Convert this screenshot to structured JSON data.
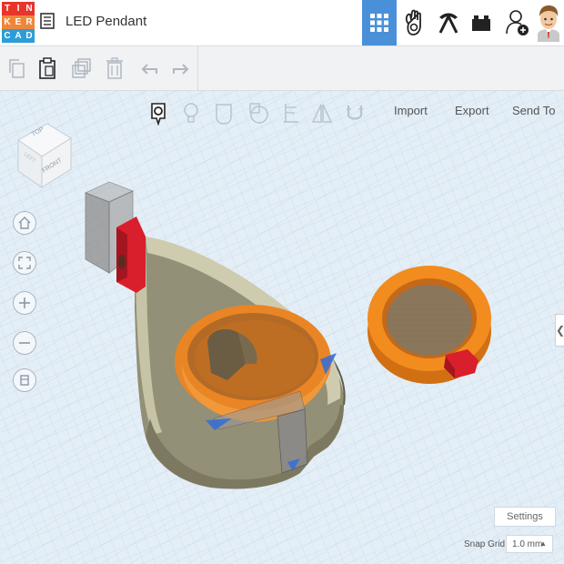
{
  "app": {
    "logo_letters": [
      "T",
      "I",
      "N",
      "K",
      "E",
      "R",
      "C",
      "A",
      "D"
    ],
    "logo_colors": [
      "#e7352b",
      "#e7352b",
      "#e7352b",
      "#f0863c",
      "#f0863c",
      "#f0863c",
      "#2c9dd8",
      "#2c9dd8",
      "#2c9dd8"
    ],
    "document_title": "LED Pendant",
    "accent_color": "#4a90d9"
  },
  "header": {
    "view_buttons": [
      {
        "name": "3d-design-icon",
        "active": true
      },
      {
        "name": "codeblocks-icon",
        "active": false
      },
      {
        "name": "circuits-icon",
        "active": false
      },
      {
        "name": "lego-brick-icon",
        "active": false
      },
      {
        "name": "add-user-icon",
        "active": false
      }
    ]
  },
  "toolbar": {
    "actions": [
      "copy-icon",
      "paste-icon",
      "duplicate-icon",
      "delete-icon",
      "undo-icon",
      "redo-icon"
    ]
  },
  "workplane": {
    "shape_tools": [
      "note-icon",
      "light-icon",
      "shape-icon",
      "workplane-icon",
      "ruler-icon",
      "mirror-icon",
      "magnet-icon"
    ],
    "menu": {
      "import": "Import",
      "export": "Export",
      "send_to": "Send To"
    },
    "viewcube": {
      "top": "TOP",
      "front": "FRONT",
      "left": "LEFT"
    },
    "nav": [
      "home-icon",
      "fit-icon",
      "zoom-in-icon",
      "zoom-out-icon",
      "ortho-icon"
    ],
    "settings_label": "Settings",
    "snap_grid_label": "Snap Grid",
    "snap_grid_value": "1.0 mm",
    "handle_glyph": "❮"
  }
}
